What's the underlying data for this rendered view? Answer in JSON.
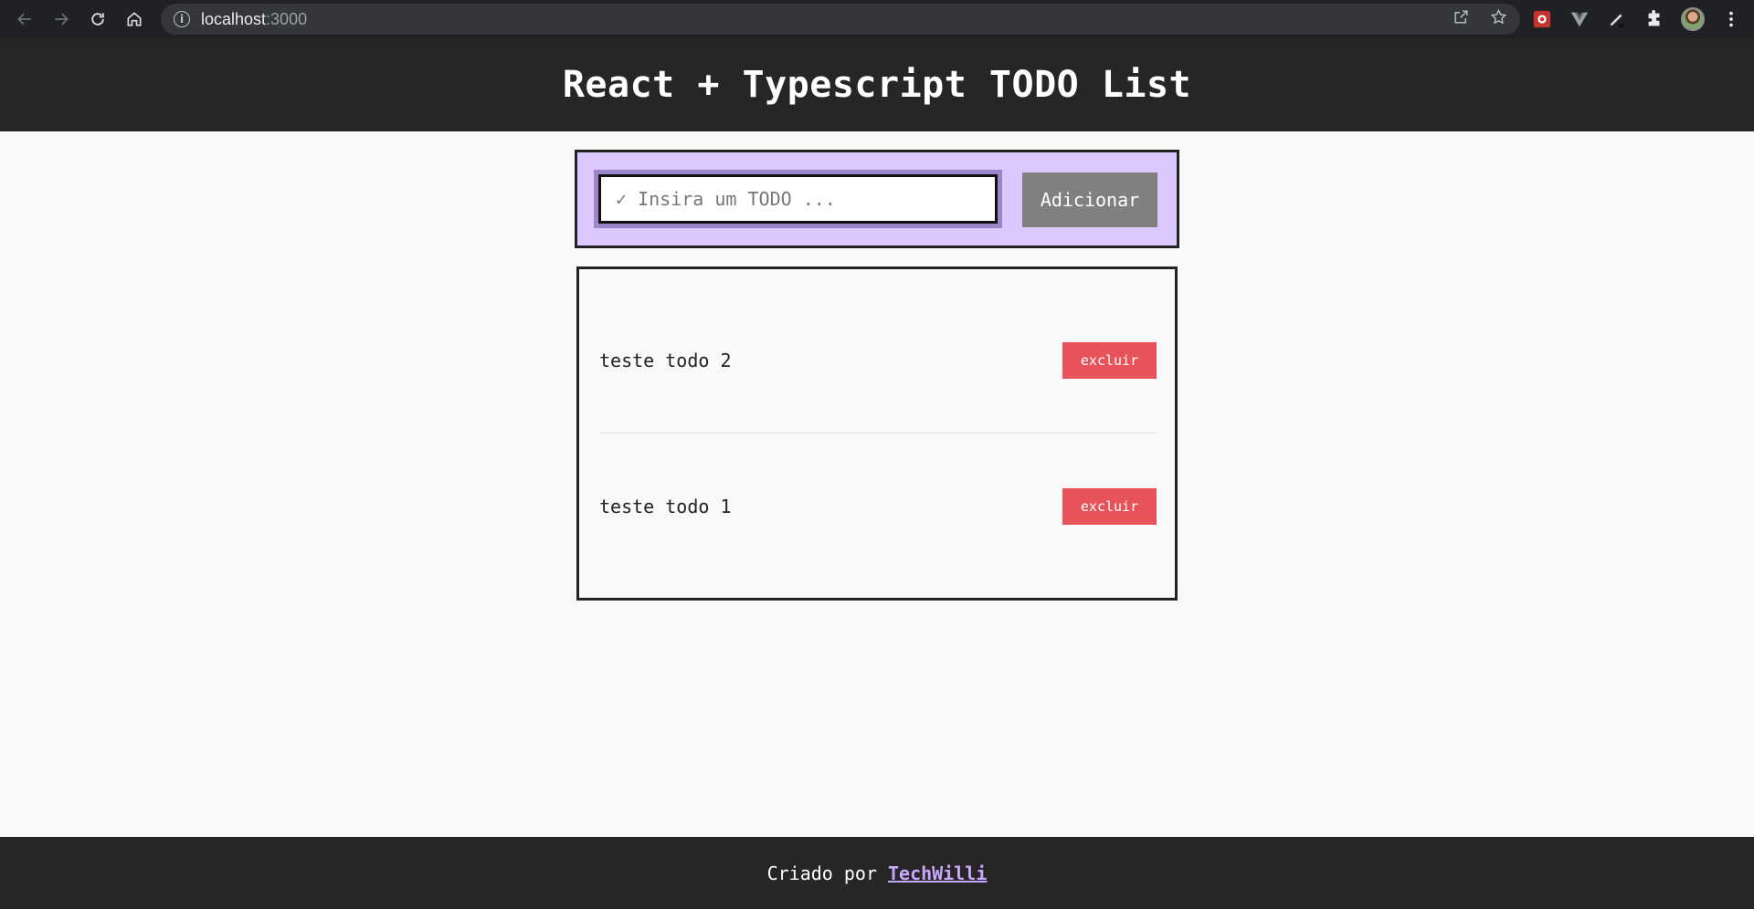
{
  "browser": {
    "url_host": "localhost",
    "url_port": ":3000"
  },
  "header": {
    "title": "React + Typescript TODO List"
  },
  "form": {
    "input_placeholder": "✓ Insira um TODO ...",
    "input_value": "",
    "add_button_label": "Adicionar"
  },
  "todos": [
    {
      "text": "teste todo 2",
      "delete_label": "excluir"
    },
    {
      "text": "teste todo 1",
      "delete_label": "excluir"
    }
  ],
  "footer": {
    "prefix": "Criado por",
    "link_text": "TechWilli"
  },
  "colors": {
    "header_bg": "#262626",
    "form_bg": "#dcc8ff",
    "add_button_bg": "#808080",
    "delete_button_bg": "#e8535a",
    "footer_link": "#c9a7ff"
  }
}
